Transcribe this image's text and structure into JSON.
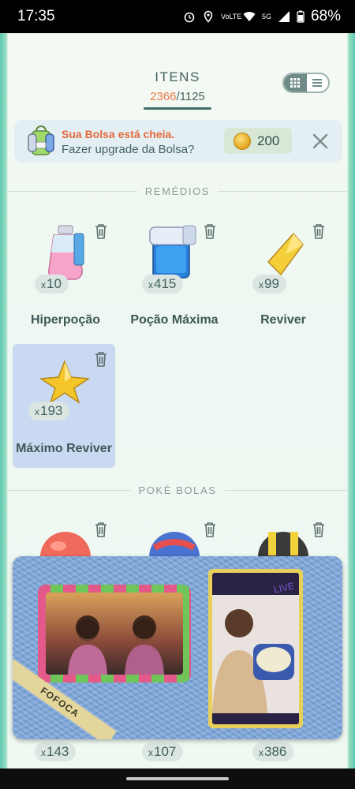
{
  "status_bar": {
    "time": "17:35",
    "network": "5G",
    "volte": "VoLTE",
    "battery": "68%"
  },
  "header": {
    "title": "ITENS",
    "count_current": "2366",
    "count_separator": "/",
    "count_max": "1125"
  },
  "bag_banner": {
    "full_text": "Sua Bolsa está cheia.",
    "upgrade_text": "Fazer upgrade da Bolsa?",
    "coin_cost": "200"
  },
  "sections": {
    "remedios": "REMÉDIOS",
    "pokebolas": "POKÉ BOLAS"
  },
  "remedios_items": [
    {
      "name": "Hiperpoção",
      "x": "x",
      "qty": "10"
    },
    {
      "name": "Poção Máxima",
      "x": "x",
      "qty": "415"
    },
    {
      "name": "Reviver",
      "x": "x",
      "qty": "99"
    },
    {
      "name": "Máximo Reviver",
      "x": "x",
      "qty": "193"
    }
  ],
  "pokebola_items": [
    {
      "x": "x",
      "qty": "143"
    },
    {
      "x": "x",
      "qty": "107"
    },
    {
      "x": "x",
      "qty": "386"
    }
  ],
  "overlay": {
    "ribbon_text": "FOFOCA",
    "screen_text": "LIVE"
  },
  "colors": {
    "accent_orange": "#e97a4a",
    "selected_cell": "#c9d9f2",
    "text_primary": "#3e5856"
  }
}
